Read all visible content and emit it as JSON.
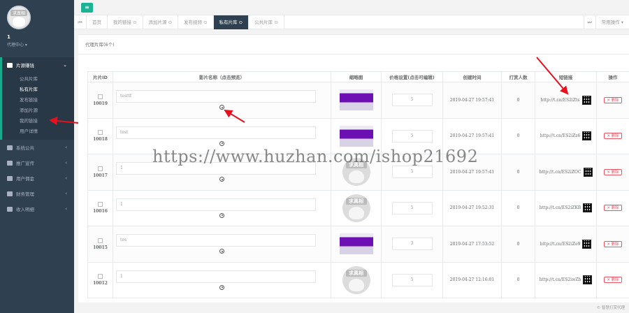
{
  "sidebar": {
    "avatar_text": "求真相",
    "user_name": "1",
    "user_role": "代理中心 ▾",
    "menu": [
      {
        "label": "片源赚钱",
        "icon": "stack-icon"
      },
      {
        "label": "系统公共",
        "icon": "gear-icon"
      },
      {
        "label": "推广宣传",
        "icon": "megaphone-icon"
      },
      {
        "label": "用户佣金",
        "icon": "users-icon"
      },
      {
        "label": "财务管理",
        "icon": "money-icon"
      },
      {
        "label": "收入明细",
        "icon": "list-icon"
      }
    ],
    "submenu": [
      "公共片库",
      "私有片库",
      "发布链接",
      "添加片源",
      "我的链接",
      "用户详情"
    ]
  },
  "topbar": {
    "menu_icon": "hamburger-icon"
  },
  "tabs": {
    "items": [
      "首页",
      "我的链接 ⊙",
      "添加片源 ⊙",
      "发布视频 ⊙",
      "私有片库 ⊙",
      "公共片库 ⊙"
    ],
    "active_index": 4,
    "ops_label": "常用操作 ▾"
  },
  "panel": {
    "title": "代理片库(6个)"
  },
  "table": {
    "headers": [
      "片片ID",
      "影片名称（点击预览）",
      "缩略图",
      "价格设置(点击可编辑)",
      "创建时间",
      "打赏人数",
      "短链接",
      "操作"
    ],
    "delete_label": "✕ 删除",
    "rows": [
      {
        "id": "10019",
        "name": "testtf",
        "thumb": "video",
        "price": "5",
        "created": "2019-04-27 19:57:41",
        "tips": "0",
        "link": "http://t.cn/ES2iZts"
      },
      {
        "id": "10018",
        "name": "test",
        "thumb": "video",
        "price": "5",
        "created": "2019-04-27 19:57:41",
        "tips": "0",
        "link": "http://t.cn/ES2iZz6"
      },
      {
        "id": "10017",
        "name": "1",
        "thumb": "avatar",
        "price": "5",
        "created": "2019-04-27 19:57:41",
        "tips": "0",
        "link": "http://t.cn/ES2iZOC"
      },
      {
        "id": "10016",
        "name": "1",
        "thumb": "avatar",
        "price": "5",
        "created": "2019-04-27 19:52:31",
        "tips": "0",
        "link": "http://t.cn/ES2iZKB"
      },
      {
        "id": "10015",
        "name": "tes",
        "thumb": "video",
        "price": "3",
        "created": "2019-04-27 17:53:52",
        "tips": "0",
        "link": "http://t.cn/ES2iZe9"
      },
      {
        "id": "10012",
        "name": "1",
        "thumb": "avatar",
        "price": "5",
        "created": "2019-04-27 12:16:01",
        "tips": "0",
        "link": "http://t.cn/ES2iwZh"
      }
    ]
  },
  "watermark": "https://www.huzhan.com/ishop21692",
  "footer": "© 智慧打赏代理",
  "colors": {
    "sidebar": "#2f4050",
    "accent": "#1ab394",
    "arrow": "#e8101c",
    "thumb_purple": "#6c0fb3",
    "danger": "#ed5565"
  }
}
